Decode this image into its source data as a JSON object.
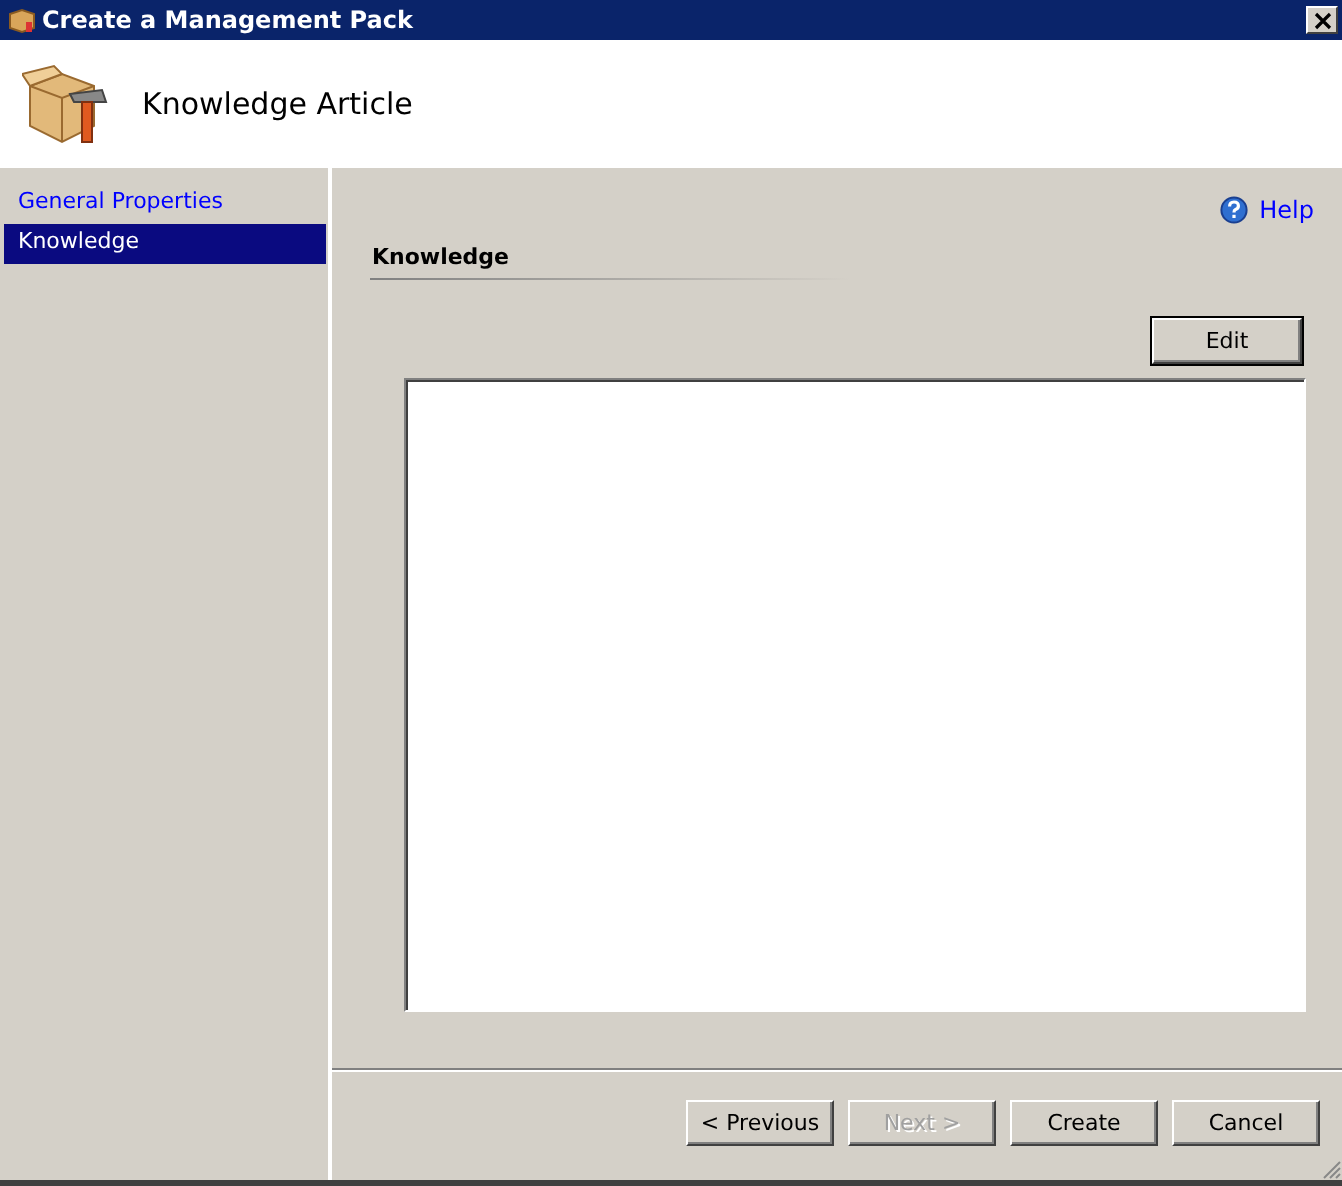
{
  "window": {
    "title": "Create a Management Pack"
  },
  "header": {
    "title": "Knowledge Article"
  },
  "sidebar": {
    "items": [
      {
        "label": "General Properties",
        "selected": false
      },
      {
        "label": "Knowledge",
        "selected": true
      }
    ]
  },
  "content": {
    "help": "Help",
    "section_title": "Knowledge",
    "edit_button": "Edit"
  },
  "buttons": [
    {
      "label": "< Previous",
      "disabled": false
    },
    {
      "label": "Next >",
      "disabled": true
    },
    {
      "label": "Create",
      "disabled": false
    },
    {
      "label": "Cancel",
      "disabled": false
    }
  ]
}
